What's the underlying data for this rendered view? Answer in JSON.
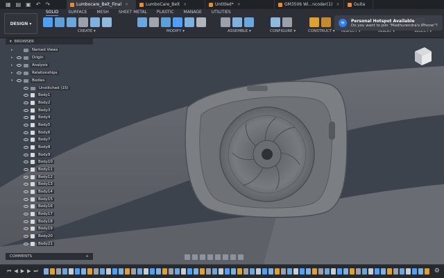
{
  "titlebar": {
    "tabs": [
      {
        "label": "Lumbocare_Belt_Final",
        "active": true
      },
      {
        "label": "LumboCare_Belt",
        "active": false
      },
      {
        "label": "Untitled*",
        "active": false
      },
      {
        "label": "GM3506 Wi...ncoder(1)",
        "active": false
      },
      {
        "label": "Guita",
        "active": false
      }
    ]
  },
  "ribbon": {
    "workspace": "DESIGN ▾",
    "tabs": [
      "SOLID",
      "SURFACE",
      "MESH",
      "SHEET METAL",
      "PLASTIC",
      "MANAGE",
      "UTILITIES"
    ],
    "active_tab": "SOLID",
    "groups": [
      "CREATE ▾",
      "MODIFY ▾",
      "ASSEMBLE ▾",
      "CONFIGURE ▾",
      "CONSTRUCT ▾",
      "INSPECT ▾",
      "INSERT ▾",
      "SELECT ▾"
    ]
  },
  "notification": {
    "title": "Personal Hotspot Available",
    "body": "Do you want to join \"Madhurendra's iPhone\"?"
  },
  "browser": {
    "title": "BROWSER",
    "tree": [
      {
        "label": "Named Views",
        "kind": "folder",
        "depth": 1,
        "eye": false
      },
      {
        "label": "Origin",
        "kind": "folder",
        "depth": 1,
        "eye": true
      },
      {
        "label": "Analysis",
        "kind": "folder",
        "depth": 1,
        "eye": true
      },
      {
        "label": "Relationships",
        "kind": "folder",
        "depth": 1,
        "eye": true
      },
      {
        "label": "Bodies",
        "kind": "folder",
        "depth": 1,
        "eye": true
      },
      {
        "label": "Unstitched (15)",
        "kind": "folder",
        "depth": 2,
        "eye": true
      },
      {
        "label": "Body1",
        "kind": "body",
        "depth": 2,
        "eye": true
      },
      {
        "label": "Body2",
        "kind": "body",
        "depth": 2,
        "eye": true
      },
      {
        "label": "Body3",
        "kind": "body",
        "depth": 2,
        "eye": true
      },
      {
        "label": "Body4",
        "kind": "body",
        "depth": 2,
        "eye": true
      },
      {
        "label": "Body5",
        "kind": "body",
        "depth": 2,
        "eye": true
      },
      {
        "label": "Body6",
        "kind": "body",
        "depth": 2,
        "eye": true
      },
      {
        "label": "Body7",
        "kind": "body",
        "depth": 2,
        "eye": true
      },
      {
        "label": "Body8",
        "kind": "body",
        "depth": 2,
        "eye": true
      },
      {
        "label": "Body9",
        "kind": "body",
        "depth": 2,
        "eye": true
      },
      {
        "label": "Body10",
        "kind": "body",
        "depth": 2,
        "eye": true
      },
      {
        "label": "Body11",
        "kind": "body",
        "depth": 2,
        "eye": true
      },
      {
        "label": "Body12",
        "kind": "body",
        "depth": 2,
        "eye": true
      },
      {
        "label": "Body13",
        "kind": "body",
        "depth": 2,
        "eye": true
      },
      {
        "label": "Body14",
        "kind": "body",
        "depth": 2,
        "eye": true
      },
      {
        "label": "Body15",
        "kind": "body",
        "depth": 2,
        "eye": true
      },
      {
        "label": "Body16",
        "kind": "body",
        "depth": 2,
        "eye": true
      },
      {
        "label": "Body17",
        "kind": "body",
        "depth": 2,
        "eye": true
      },
      {
        "label": "Body18",
        "kind": "body",
        "depth": 2,
        "eye": true
      },
      {
        "label": "Body19",
        "kind": "body",
        "depth": 2,
        "eye": true
      },
      {
        "label": "Body20",
        "kind": "body",
        "depth": 2,
        "eye": true
      },
      {
        "label": "Body21",
        "kind": "body",
        "depth": 2,
        "eye": true
      }
    ]
  },
  "comments": {
    "title": "COMMENTS",
    "add": "+"
  },
  "colors": {
    "accent": "#4ea0ff",
    "viewport": "#3d434c",
    "panel": "#2c3036"
  }
}
